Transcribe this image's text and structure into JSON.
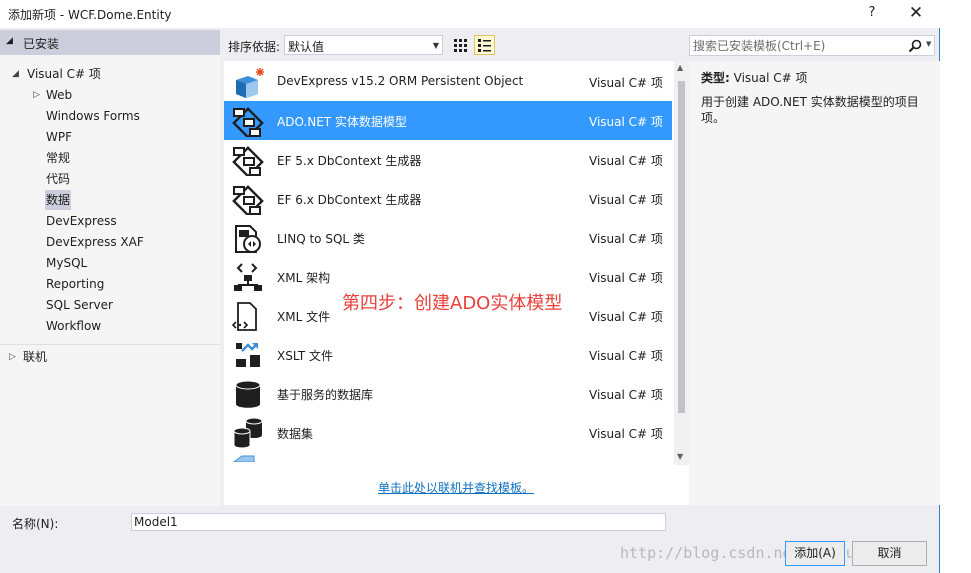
{
  "window": {
    "title": "添加新项 - WCF.Dome.Entity",
    "help_label": "?",
    "close_label": "✕"
  },
  "tree": {
    "installed_label": "已安装",
    "items": [
      {
        "label": "Visual C# 项",
        "arrow": "◢"
      },
      {
        "label": "Web",
        "arrow": "▷"
      },
      {
        "label": "Windows Forms"
      },
      {
        "label": "WPF"
      },
      {
        "label": "常规"
      },
      {
        "label": "代码"
      },
      {
        "label": "数据",
        "selected": true
      },
      {
        "label": "DevExpress"
      },
      {
        "label": "DevExpress XAF"
      },
      {
        "label": "MySQL"
      },
      {
        "label": "Reporting"
      },
      {
        "label": "SQL Server"
      },
      {
        "label": "Workflow"
      }
    ],
    "online_label": "联机"
  },
  "toolbar": {
    "sort_label": "排序依据:",
    "sort_value": "默认值"
  },
  "search": {
    "placeholder": "搜索已安装模板(Ctrl+E)"
  },
  "templates": [
    {
      "name": "DevExpress v15.2 ORM Persistent Object",
      "lang": "Visual C# 项",
      "icon": "devexpress-orm-icon"
    },
    {
      "name": "ADO.NET 实体数据模型",
      "lang": "Visual C# 项",
      "icon": "entity-model-icon",
      "selected": true
    },
    {
      "name": "EF 5.x DbContext 生成器",
      "lang": "Visual C# 项",
      "icon": "dbcontext-generator-icon"
    },
    {
      "name": "EF 6.x DbContext 生成器",
      "lang": "Visual C# 项",
      "icon": "dbcontext-generator-icon"
    },
    {
      "name": "LINQ to SQL 类",
      "lang": "Visual C# 项",
      "icon": "linq-to-sql-icon"
    },
    {
      "name": "XML 架构",
      "lang": "Visual C# 项",
      "icon": "xml-schema-icon"
    },
    {
      "name": "XML 文件",
      "lang": "Visual C# 项",
      "icon": "xml-file-icon"
    },
    {
      "name": "XSLT 文件",
      "lang": "Visual C# 项",
      "icon": "xslt-file-icon"
    },
    {
      "name": "基于服务的数据库",
      "lang": "Visual C# 项",
      "icon": "database-icon"
    },
    {
      "name": "数据集",
      "lang": "Visual C# 项",
      "icon": "dataset-icon"
    }
  ],
  "online_link": "单击此处以联机并查找模板。",
  "annotation": "第四步：创建ADO实体模型",
  "details": {
    "type_key": "类型:",
    "type_value": "Visual C# 项",
    "description": "用于创建 ADO.NET 实体数据模型的项目项。"
  },
  "footer": {
    "name_label": "名称(N):",
    "name_value": "Model1",
    "add_label": "添加(A)",
    "cancel_label": "取消"
  },
  "watermark": "http://blog.csdn.net/zoutulobang1",
  "colors": {
    "selection": "#3399ff",
    "tree_selection": "#cccedb",
    "link": "#0e70c0",
    "annotation": "#e8413b",
    "dialog_border": "#2d7fc3"
  }
}
